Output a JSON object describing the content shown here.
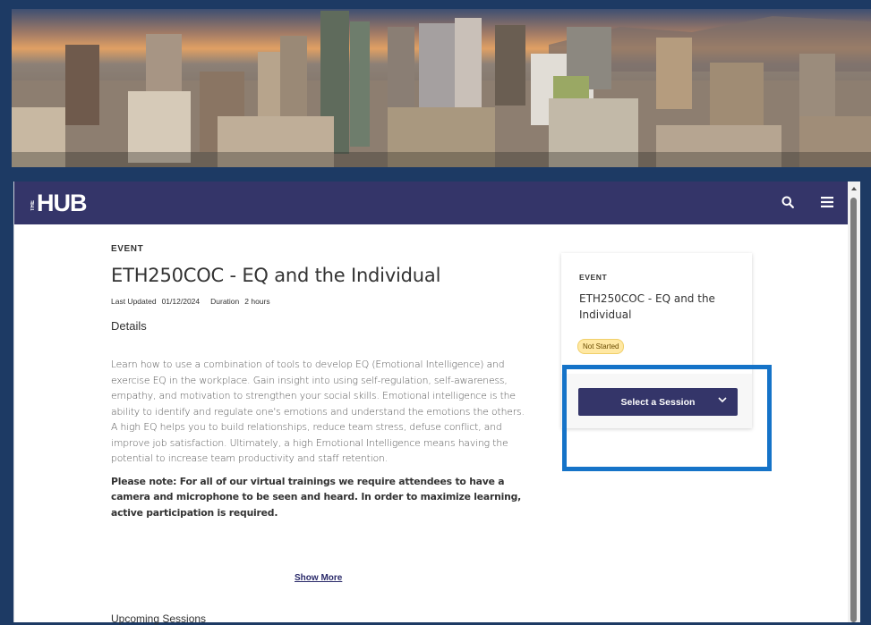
{
  "navbar": {
    "logo_small": "THE",
    "logo_text": "HUB",
    "icons": [
      "search-icon",
      "menu-icon"
    ]
  },
  "event": {
    "eyebrow": "EVENT",
    "title": "ETH250COC - EQ and the Individual",
    "last_updated_label": "Last Updated",
    "last_updated_value": "01/12/2024",
    "duration_label": "Duration",
    "duration_value": "2 hours",
    "details_heading": "Details",
    "description": "Learn how to use a combination of tools to develop EQ (Emotional Intelligence) and exercise EQ in the workplace. Gain insight into using self-regulation, self-awareness, empathy, and motivation to strengthen your social skills. Emotional intelligence is the ability to identify and regulate one's emotions and understand the emotions the others. A high EQ helps you to build relationships, reduce team stress, defuse conflict, and improve job satisfaction. Ultimately, a high Emotional Intelligence means having the potential to increase team productivity and staff retention.",
    "note": "Please note: For all of our virtual trainings we require attendees to have a camera and microphone to be seen and heard. In order to maximize learning, active participation is required.",
    "show_more": "Show More",
    "upcoming_heading": "Upcoming Sessions"
  },
  "card": {
    "eyebrow": "EVENT",
    "title": "ETH250COC - EQ and the Individual",
    "status": "Not Started",
    "select_label": "Select a Session"
  },
  "colors": {
    "brand": "#343569",
    "highlight": "#1573c8",
    "badge_bg": "#ffe8a3"
  }
}
